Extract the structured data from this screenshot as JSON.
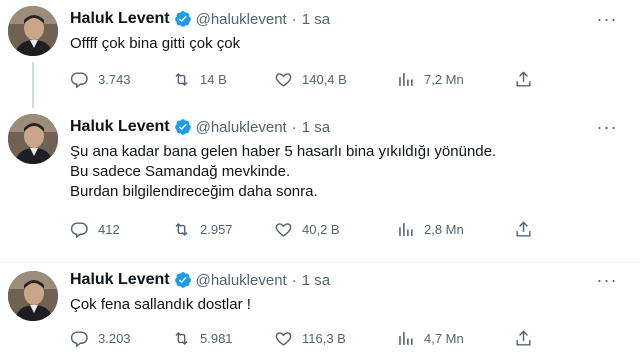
{
  "tweets": [
    {
      "author": {
        "name": "Haluk Levent",
        "handle": "@haluklevent"
      },
      "separator": "·",
      "time": "1 sa",
      "lines": [
        "Offff çok bina gitti çok çok"
      ],
      "replies": "3.743",
      "retweets": "14 B",
      "likes": "140,4 B",
      "views": "7,2 Mn"
    },
    {
      "author": {
        "name": "Haluk Levent",
        "handle": "@haluklevent"
      },
      "separator": "·",
      "time": "1 sa",
      "lines": [
        "Şu ana kadar bana gelen haber 5 hasarlı bina yıkıldığı yönünde.",
        "Bu sadece Samandağ mevkinde.",
        "Burdan bilgilendireceğim daha sonra."
      ],
      "replies": "412",
      "retweets": "2.957",
      "likes": "40,2 B",
      "views": "2,8 Mn"
    },
    {
      "author": {
        "name": "Haluk Levent",
        "handle": "@haluklevent"
      },
      "separator": "·",
      "time": "1 sa",
      "lines": [
        "Çok fena sallandık dostlar !"
      ],
      "replies": "3.203",
      "retweets": "5.981",
      "likes": "116,3 B",
      "views": "4,7 Mn"
    }
  ],
  "icons": {
    "verified": "verified-badge-icon",
    "more": "more-options-icon",
    "reply": "reply-icon",
    "retweet": "retweet-icon",
    "like": "heart-icon",
    "views": "views-chart-icon",
    "share": "share-icon"
  },
  "colors": {
    "verified_blue": "#1d9bf0",
    "secondary_text": "#536471",
    "primary_text": "#0f1419",
    "divider": "#eff3f4"
  }
}
